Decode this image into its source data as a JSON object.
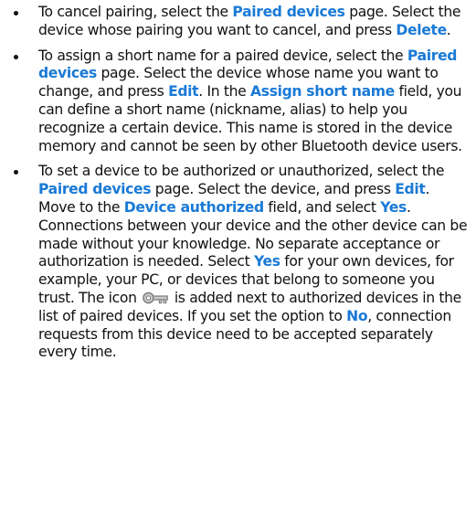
{
  "colors": {
    "text": "#111111",
    "keyword": "#1a7ad6"
  },
  "items": [
    {
      "parts": [
        {
          "t": "To cancel pairing, select the "
        },
        {
          "k": "Paired devices"
        },
        {
          "t": " page. Select the device whose pairing you want to cancel, and press "
        },
        {
          "k": "Delete"
        },
        {
          "t": "."
        }
      ]
    },
    {
      "parts": [
        {
          "t": "To assign a short name for a paired device, select the "
        },
        {
          "k": "Paired devices"
        },
        {
          "t": " page. Select the device whose name you want to change, and press "
        },
        {
          "k": "Edit"
        },
        {
          "t": ". In the "
        },
        {
          "k": "Assign short name"
        },
        {
          "t": " field, you can define a short name (nickname, alias) to help you recognize a certain device. This name is stored in the device memory and cannot be seen by other Bluetooth device users."
        }
      ]
    },
    {
      "parts": [
        {
          "t": "To set a device to be authorized or unauthorized, select the "
        },
        {
          "k": "Paired devices"
        },
        {
          "t": " page. Select the device, and press "
        },
        {
          "k": "Edit"
        },
        {
          "t": ". Move to the "
        },
        {
          "k": "Device authorized"
        },
        {
          "t": " field, and select "
        },
        {
          "k": "Yes"
        },
        {
          "t": ". Connections between your device and the other device can be made without your knowledge. No separate acceptance or authorization is needed. Select "
        },
        {
          "k": "Yes"
        },
        {
          "t": " for your own devices, for example, your PC, or devices that belong to someone you trust. The icon "
        },
        {
          "icon": "key-icon"
        },
        {
          "t": " is added next to authorized devices in the list of paired devices. If you set the option to "
        },
        {
          "k": "No"
        },
        {
          "t": ", connection requests from this device need to be accepted separately every time."
        }
      ]
    }
  ]
}
